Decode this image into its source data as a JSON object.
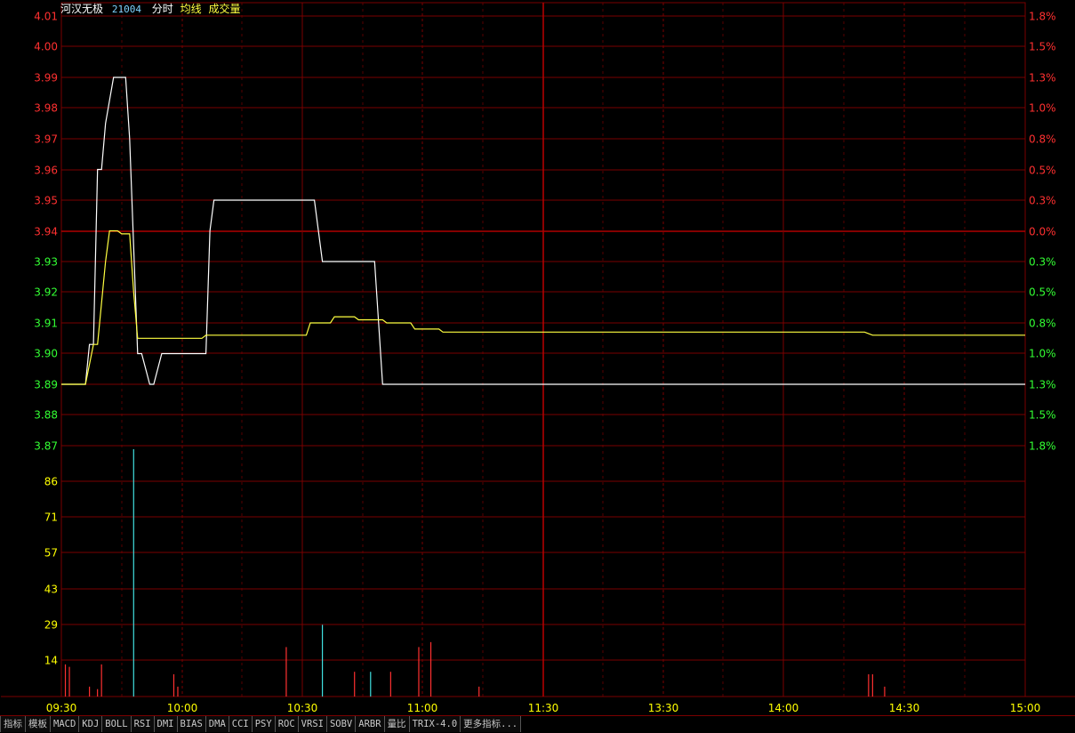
{
  "header": {
    "stock_name": "河汉无极",
    "stock_code": "21004",
    "opt_time": "分时",
    "opt_avg": "均线",
    "opt_volume": "成交量"
  },
  "colors": {
    "grid": "#7a0000",
    "axis_up": "#ff3030",
    "axis_down": "#33ff33",
    "axis_vol": "#ffff00",
    "price_line": "#ffffff",
    "avg_line": "#ffff40",
    "vol_up": "#ff3030",
    "vol_down": "#40e0e0",
    "time_label": "#ffff00"
  },
  "chart_data": [
    {
      "type": "line",
      "title": "",
      "y_ticks_left": [
        "4.01",
        "4.00",
        "3.99",
        "3.98",
        "3.97",
        "3.96",
        "3.95",
        "3.94",
        "3.93",
        "3.92",
        "3.91",
        "3.90",
        "3.89",
        "3.88",
        "3.87"
      ],
      "y_ticks_right": [
        "1.8%",
        "1.5%",
        "1.3%",
        "1.0%",
        "0.8%",
        "0.5%",
        "0.3%",
        "0.0%",
        "0.3%",
        "0.5%",
        "0.8%",
        "1.0%",
        "1.3%",
        "1.5%",
        "1.8%"
      ],
      "ylim": [
        3.87,
        4.01
      ],
      "prev_close": 3.94,
      "x_labels": [
        "09:30",
        "10:00",
        "10:30",
        "11:00",
        "11:30",
        "13:30",
        "14:00",
        "14:30",
        "15:00"
      ],
      "xlim": [
        0,
        240
      ],
      "series": [
        {
          "points": [
            [
              0,
              3.89
            ],
            [
              6,
              3.89
            ],
            [
              7,
              3.903
            ],
            [
              8,
              3.903
            ],
            [
              9,
              3.96
            ],
            [
              10,
              3.96
            ],
            [
              11,
              3.975
            ],
            [
              13,
              3.99
            ],
            [
              16,
              3.99
            ],
            [
              17,
              3.97
            ],
            [
              19,
              3.9
            ],
            [
              20,
              3.9
            ],
            [
              22,
              3.89
            ],
            [
              23,
              3.89
            ],
            [
              25,
              3.9
            ],
            [
              36,
              3.9
            ],
            [
              37,
              3.94
            ],
            [
              38,
              3.95
            ],
            [
              63,
              3.95
            ],
            [
              64,
              3.94
            ],
            [
              65,
              3.93
            ],
            [
              78,
              3.93
            ],
            [
              79,
              3.91
            ],
            [
              80,
              3.89
            ],
            [
              240,
              3.89
            ]
          ]
        },
        {
          "points": [
            [
              0,
              3.89
            ],
            [
              6,
              3.89
            ],
            [
              8,
              3.903
            ],
            [
              9,
              3.903
            ],
            [
              11,
              3.93
            ],
            [
              12,
              3.94
            ],
            [
              14,
              3.94
            ],
            [
              15,
              3.939
            ],
            [
              17,
              3.939
            ],
            [
              18,
              3.92
            ],
            [
              19,
              3.905
            ],
            [
              35,
              3.905
            ],
            [
              36,
              3.906
            ],
            [
              55,
              3.906
            ],
            [
              61,
              3.906
            ],
            [
              62,
              3.91
            ],
            [
              67,
              3.91
            ],
            [
              68,
              3.912
            ],
            [
              73,
              3.912
            ],
            [
              74,
              3.911
            ],
            [
              80,
              3.911
            ],
            [
              81,
              3.91
            ],
            [
              87,
              3.91
            ],
            [
              88,
              3.908
            ],
            [
              94,
              3.908
            ],
            [
              95,
              3.907
            ],
            [
              200,
              3.907
            ],
            [
              202,
              3.906
            ],
            [
              240,
              3.906
            ]
          ]
        }
      ]
    },
    {
      "type": "bar",
      "title": "",
      "y_ticks": [
        "86",
        "71",
        "57",
        "43",
        "29",
        "14"
      ],
      "ylim": [
        0,
        100
      ],
      "volume_up": [
        [
          1,
          13
        ],
        [
          2,
          12
        ],
        [
          7,
          4
        ],
        [
          9,
          3
        ],
        [
          10,
          13
        ],
        [
          28,
          9
        ],
        [
          29,
          4
        ],
        [
          82,
          10
        ],
        [
          89,
          20
        ],
        [
          92,
          22
        ],
        [
          201,
          9
        ],
        [
          202,
          9
        ],
        [
          205,
          4
        ],
        [
          104,
          4
        ],
        [
          56,
          20
        ],
        [
          73,
          10
        ]
      ],
      "volume_down": [
        [
          18,
          100
        ],
        [
          65,
          29
        ],
        [
          77,
          10
        ]
      ]
    }
  ],
  "tabs": [
    "指标",
    "模板",
    "MACD",
    "KDJ",
    "BOLL",
    "RSI",
    "DMI",
    "BIAS",
    "DMA",
    "CCI",
    "PSY",
    "ROC",
    "VRSI",
    "SOBV",
    "ARBR",
    "量比",
    "TRIX-4.0",
    "更多指标..."
  ]
}
